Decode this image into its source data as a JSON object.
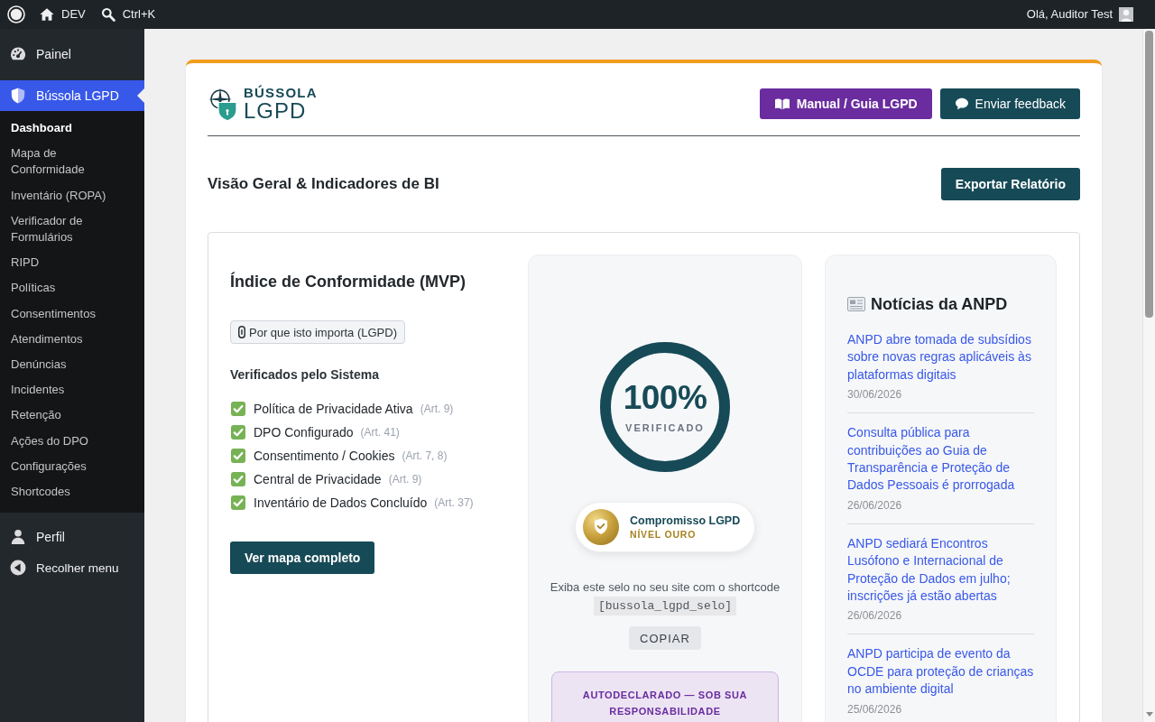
{
  "admin_bar": {
    "site_name": "DEV",
    "search_shortcut": "Ctrl+K",
    "greeting": "Olá, Auditor Test"
  },
  "sidebar": {
    "items": [
      {
        "label": "Painel",
        "selected": false
      },
      {
        "label": "Bússola LGPD",
        "selected": true,
        "children": [
          {
            "label": "Dashboard",
            "selected": true
          },
          {
            "label": "Mapa de Conformidade",
            "selected": false
          },
          {
            "label": "Inventário (ROPA)",
            "selected": false
          },
          {
            "label": "Verificador de Formulários",
            "selected": false
          },
          {
            "label": "RIPD",
            "selected": false
          },
          {
            "label": "Políticas",
            "selected": false
          },
          {
            "label": "Consentimentos",
            "selected": false
          },
          {
            "label": "Atendimentos",
            "selected": false
          },
          {
            "label": "Denúncias",
            "selected": false
          },
          {
            "label": "Incidentes",
            "selected": false
          },
          {
            "label": "Retenção",
            "selected": false
          },
          {
            "label": "Ações do DPO",
            "selected": false
          },
          {
            "label": "Configurações",
            "selected": false
          },
          {
            "label": "Shortcodes",
            "selected": false
          }
        ]
      },
      {
        "label": "Perfil",
        "selected": false
      }
    ],
    "collapse_label": "Recolher menu"
  },
  "header": {
    "brand": {
      "name": "BÚSSOLA",
      "subtitle": "LGPD"
    },
    "buttons": [
      {
        "label": "Manual / Guia LGPD",
        "kind": "guide"
      },
      {
        "label": "Enviar feedback",
        "kind": "feedback"
      }
    ]
  },
  "page_title": "Visão Geral & Indicadores de BI",
  "export_button": "Exportar Relatório",
  "compliance": {
    "title": "Índice de Conformidade (MVP)",
    "info_button": "Por que isto importa (LGPD)",
    "checks_title": "Verificados pelo Sistema",
    "checks": [
      {
        "label": "Política de Privacidade Ativa",
        "reference": "(Art. 9)",
        "checked": true
      },
      {
        "label": "DPO Configurado",
        "reference": "(Art. 41)",
        "checked": true
      },
      {
        "label": "Consentimento / Cookies",
        "reference": "(Art. 7, 8)",
        "checked": true
      },
      {
        "label": "Central de Privacidade",
        "reference": "(Art. 9)",
        "checked": true
      },
      {
        "label": "Inventário de Dados Concluído",
        "reference": "(Art. 37)",
        "checked": true
      }
    ],
    "map_button": "Ver mapa completo"
  },
  "seal_card": {
    "score": {
      "value": "100%",
      "label": "VERIFICADO",
      "level": 1
    },
    "badge": {
      "title": "Compromisso LGPD",
      "tier": "NÍVEL OURO"
    },
    "hint": "Exiba este selo no seu site com o shortcode",
    "shortcode": "[bussola_lgpd_selo]",
    "copy_button": "COPIAR",
    "notice": "AUTODECLARADO — SOB SUA RESPONSABILIDADE"
  },
  "news": {
    "title": "Notícias da ANPD",
    "items": [
      {
        "title": "ANPD abre tomada de subsídios sobre novas regras aplicáveis às plataformas digitais",
        "date": "30/06/2026"
      },
      {
        "title": "Consulta pública para contribuições ao Guia de Transparência e Proteção de Dados Pessoais é prorrogada",
        "date": "26/06/2026"
      },
      {
        "title": "ANPD sediará Encontros Lusófono e Internacional de Proteção de Dados em julho; inscrições já estão abertas",
        "date": "26/06/2026"
      },
      {
        "title": "ANPD participa de evento da OCDE para proteção de crianças no ambiente digital",
        "date": "25/06/2026"
      }
    ]
  }
}
